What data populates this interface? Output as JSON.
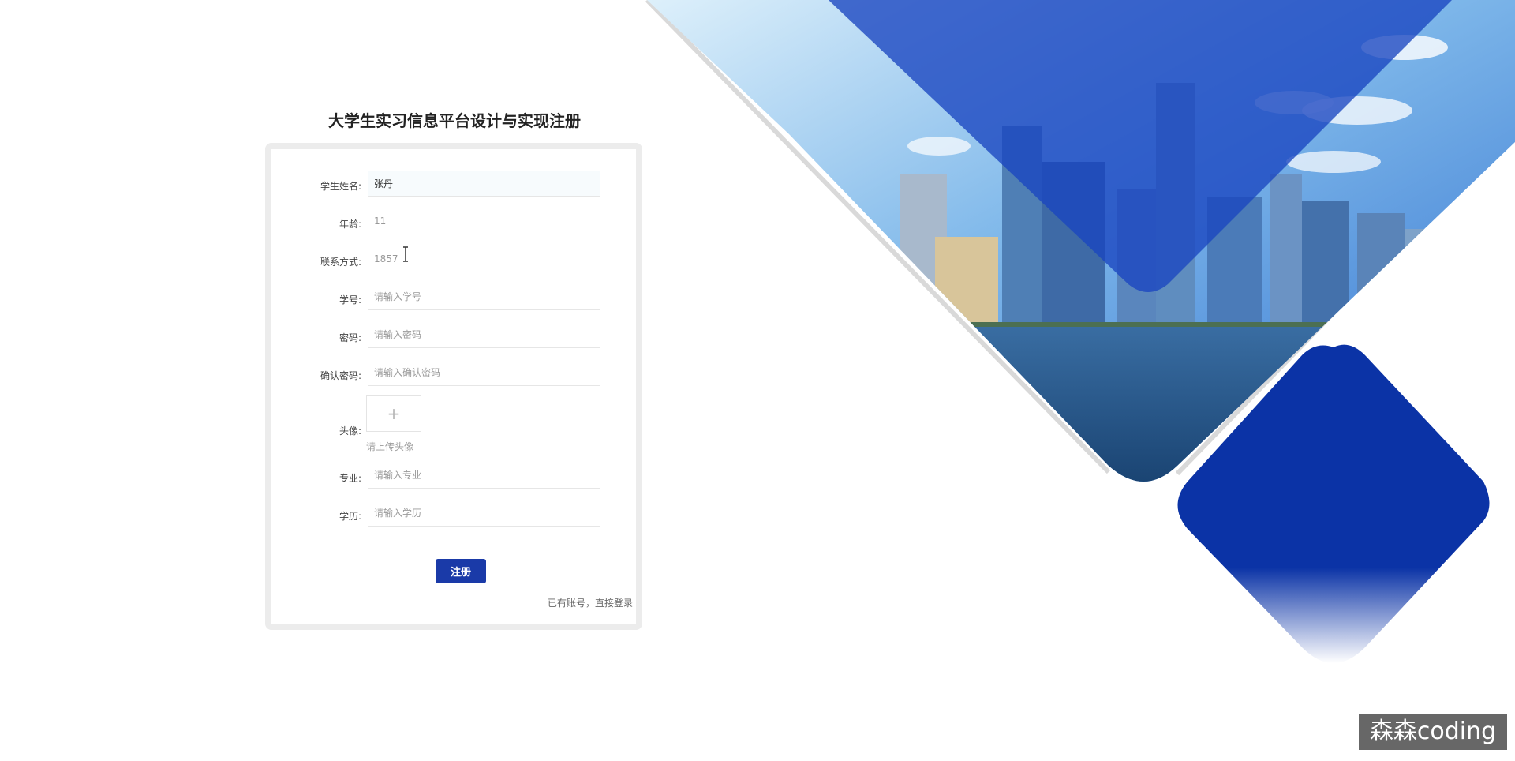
{
  "page": {
    "title": "大学生实习信息平台设计与实现注册"
  },
  "form": {
    "fields": [
      {
        "label": "学生姓名:",
        "value": "张丹",
        "placeholder": ""
      },
      {
        "label": "年龄:",
        "value": "11",
        "placeholder": ""
      },
      {
        "label": "联系方式:",
        "value": "1857",
        "placeholder": ""
      },
      {
        "label": "学号:",
        "value": "",
        "placeholder": "请输入学号"
      },
      {
        "label": "密码:",
        "value": "",
        "placeholder": "请输入密码"
      },
      {
        "label": "确认密码:",
        "value": "",
        "placeholder": "请输入确认密码"
      }
    ],
    "avatar": {
      "label": "头像:",
      "upload_icon": "plus-icon",
      "hint": "请上传头像"
    },
    "fields_after": [
      {
        "label": "专业:",
        "value": "",
        "placeholder": "请输入专业"
      },
      {
        "label": "学历:",
        "value": "",
        "placeholder": "请输入学历"
      }
    ],
    "submit_label": "注册",
    "login_link": "已有账号，直接登录"
  },
  "watermark": "森森coding",
  "colors": {
    "primary": "#1a3aa8",
    "diamond": "#0b33a6",
    "sky": "#3f7fd4"
  }
}
